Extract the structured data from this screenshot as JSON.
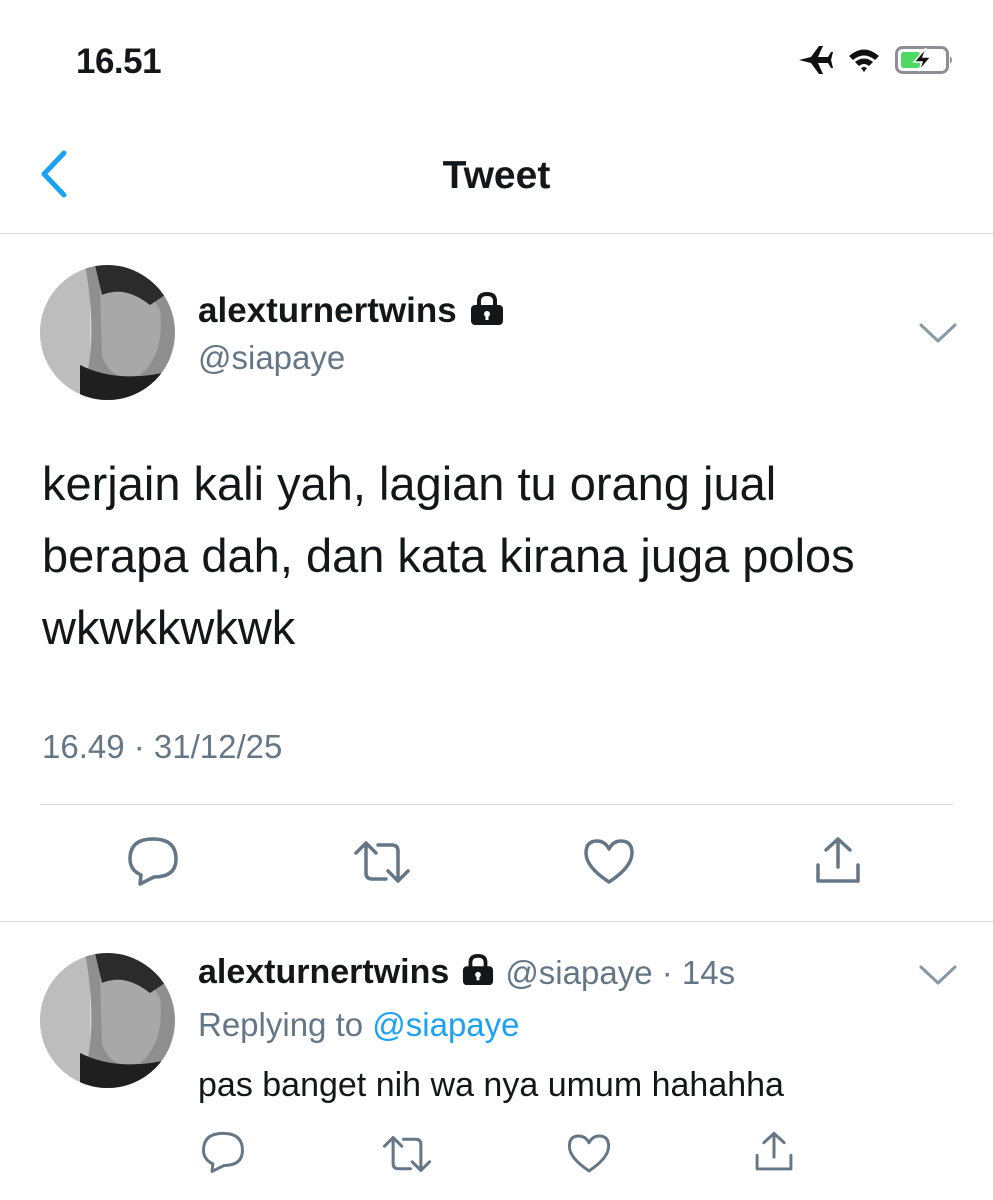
{
  "status_bar": {
    "time": "16.51",
    "icons": [
      "airplane-icon",
      "wifi-icon",
      "battery-charging-icon"
    ]
  },
  "nav": {
    "back_icon": "chevron-left-icon",
    "title": "Tweet"
  },
  "main_tweet": {
    "display_name": "alexturnertwins",
    "handle": "@siapaye",
    "protected_icon": "lock-icon",
    "menu_icon": "chevron-down-icon",
    "text_lines": [
      "kerjain kali yah, lagian tu orang jual",
      "berapa dah, dan kata kirana juga polos",
      "wkwkkwkwk"
    ],
    "timestamp": "16.49 · 31/12/25",
    "actions": [
      "reply-icon",
      "retweet-icon",
      "like-icon",
      "share-icon"
    ]
  },
  "reply_tweet": {
    "display_name": "alexturnertwins",
    "handle_time": "@siapaye · 14s",
    "protected_icon": "lock-icon",
    "menu_icon": "chevron-down-icon",
    "replying_prefix": "Replying to ",
    "replying_mention": "@siapaye",
    "text": "pas banget nih wa nya umum hahahha",
    "actions": [
      "reply-icon",
      "retweet-icon",
      "like-icon",
      "share-icon"
    ]
  },
  "colors": {
    "accent": "#1da1f2",
    "secondary_text": "#657786",
    "divider": "#d4d8db",
    "battery_green": "#4cd964"
  }
}
